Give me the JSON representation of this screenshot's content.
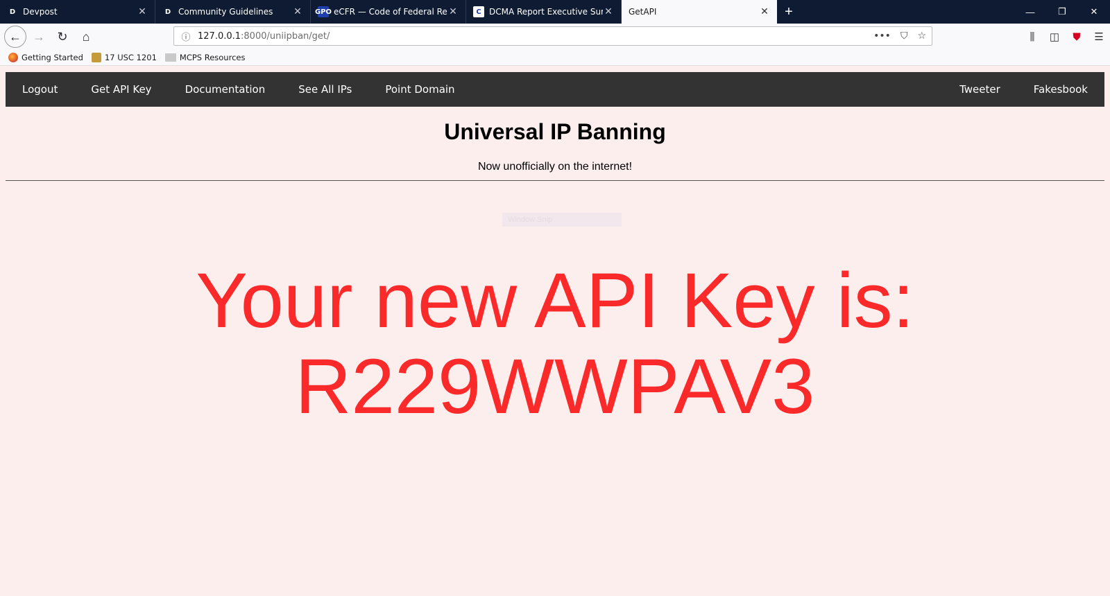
{
  "browser": {
    "tabs": [
      {
        "favicon": "D",
        "title": "Devpost",
        "active": false
      },
      {
        "favicon": "D",
        "title": "Community Guidelines",
        "active": false
      },
      {
        "favicon": "GPO",
        "title": "eCFR — Code of Federal Regula",
        "active": false
      },
      {
        "favicon": "C",
        "title": "DCMA Report Executive Summ",
        "active": false
      },
      {
        "favicon": "",
        "title": "GetAPI",
        "active": true
      }
    ],
    "url_host": "127.0.0.1",
    "url_path": ":8000/uniipban/get/",
    "bookmarks": [
      "Getting Started",
      "17 USC 1201",
      "MCPS Resources"
    ]
  },
  "nav": {
    "left": [
      "Logout",
      "Get API Key",
      "Documentation",
      "See All IPs",
      "Point Domain"
    ],
    "right": [
      "Tweeter",
      "Fakesbook"
    ]
  },
  "page": {
    "title": "Universal IP Banning",
    "tagline": "Now unofficially on the internet!",
    "snip_label": "Window Snip",
    "api_line1": "Your new API Key is:",
    "api_key": "R229WWPAV3"
  },
  "colors": {
    "accent_red": "#fb2a2a",
    "navbar": "#333333",
    "page_bg": "#fdeeee"
  }
}
